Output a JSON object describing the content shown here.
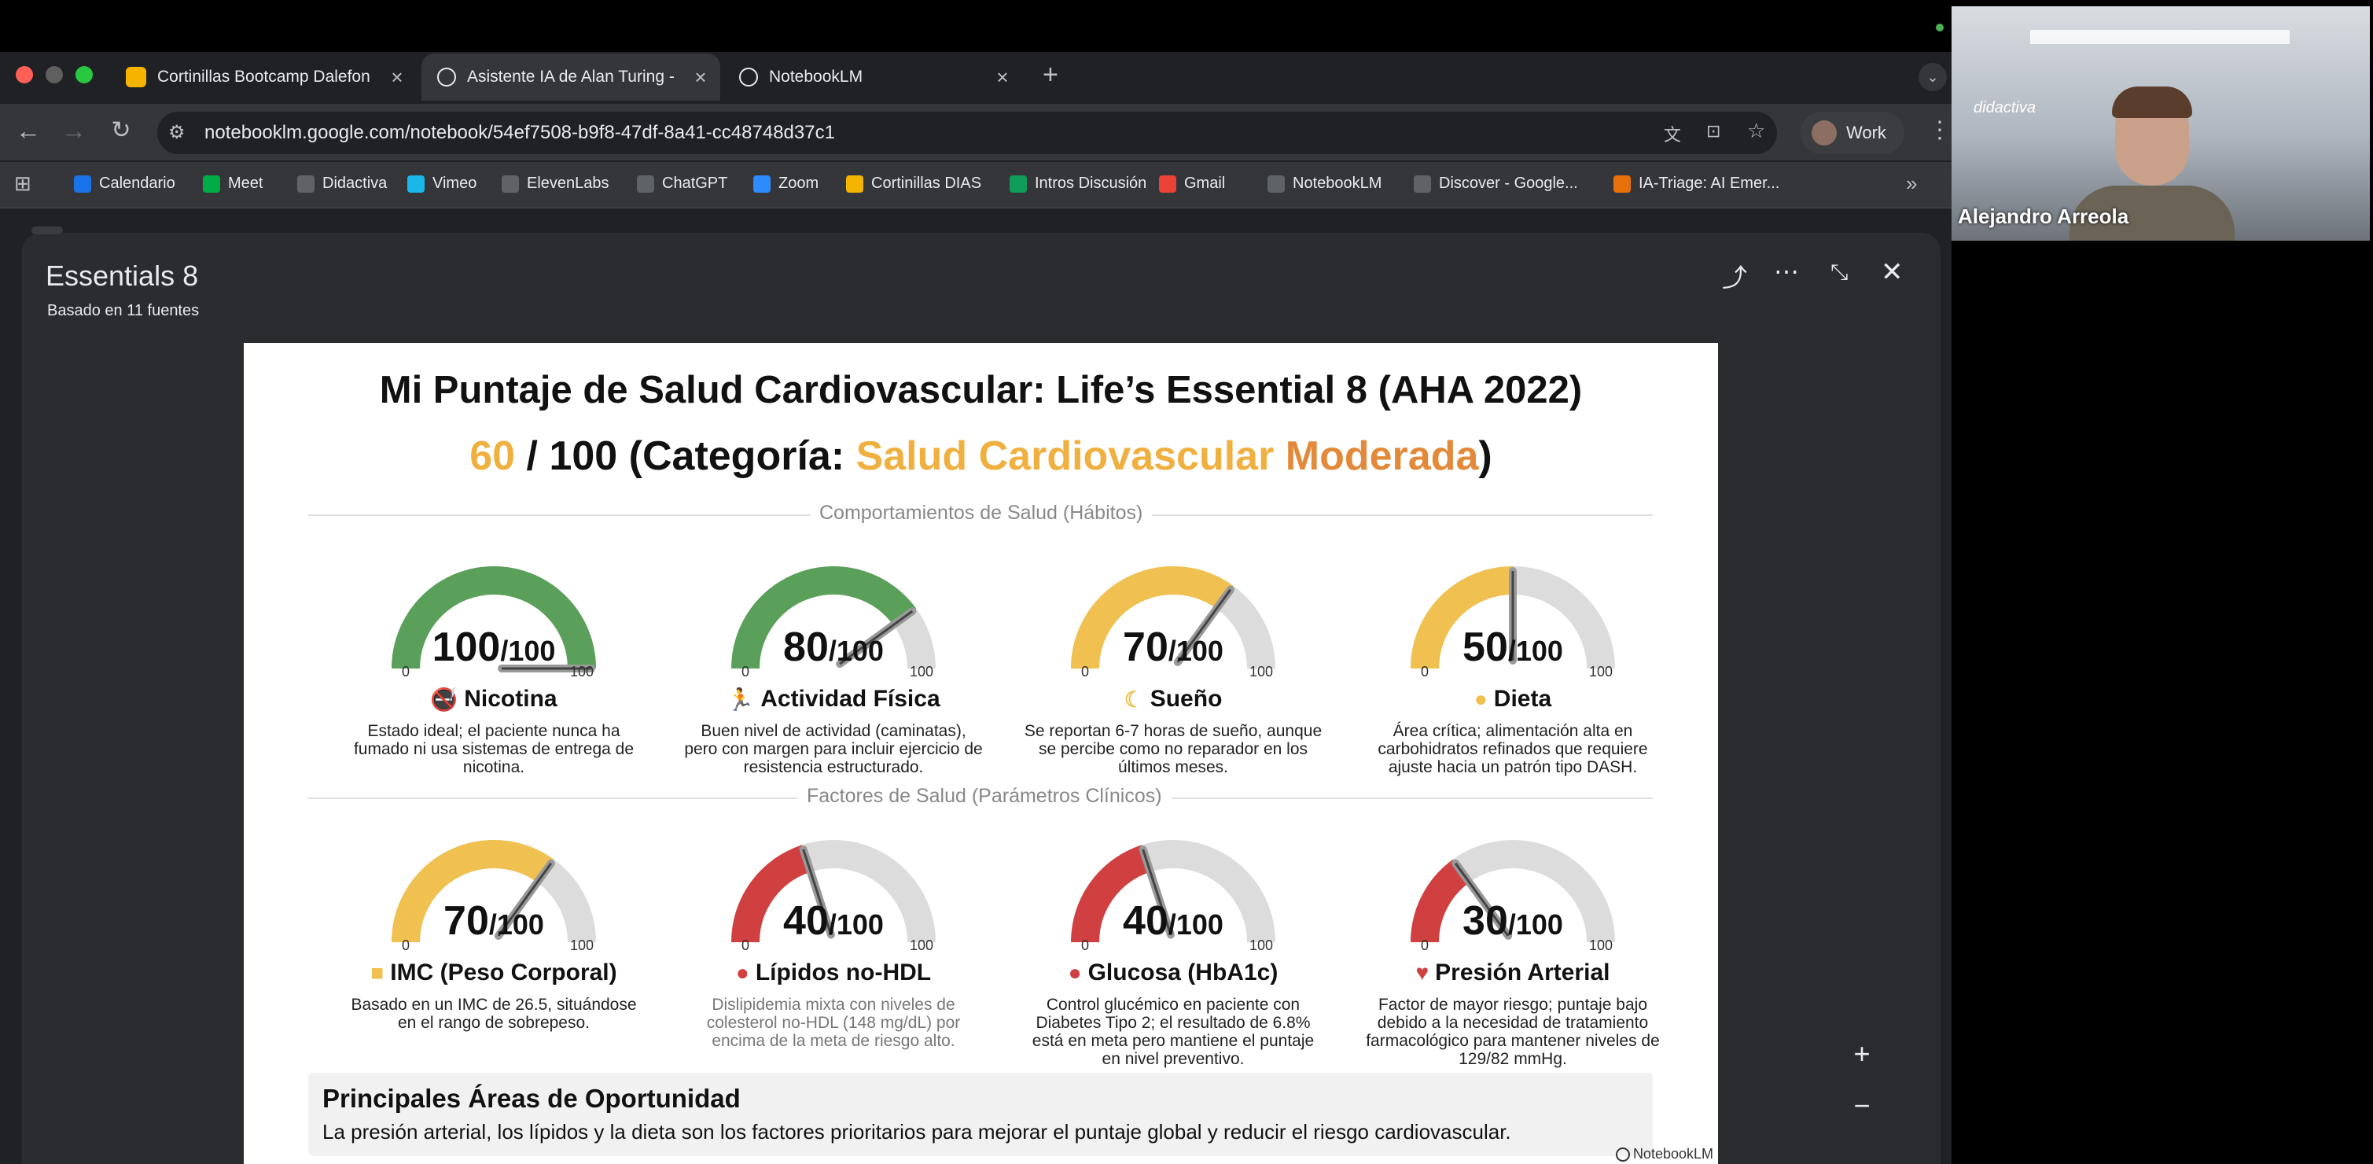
{
  "browser": {
    "tabs": [
      {
        "label": "Cortinillas Bootcamp Dalefon",
        "icon": "slides-icon"
      },
      {
        "label": "Asistente IA de Alan Turing - ",
        "icon": "notebooklm-icon",
        "active": true
      },
      {
        "label": "NotebookLM",
        "icon": "notebooklm-icon"
      }
    ],
    "url": "notebooklm.google.com/notebook/54ef7508-b9f8-47df-8a41-cc48748d37c1",
    "profile_label": "Work",
    "bookmarks": [
      {
        "label": "Calendario",
        "color": "#1a73e8"
      },
      {
        "label": "Meet",
        "color": "#00ac47"
      },
      {
        "label": "Didactiva",
        "color": "#5f6368"
      },
      {
        "label": "Vimeo",
        "color": "#1ab7ea"
      },
      {
        "label": "ElevenLabs",
        "color": "#5f6368"
      },
      {
        "label": "ChatGPT",
        "color": "#5f6368"
      },
      {
        "label": "Zoom",
        "color": "#2d8cff"
      },
      {
        "label": "Cortinillas DIAS",
        "color": "#f4b400"
      },
      {
        "label": "Intros Discusión",
        "color": "#0f9d58"
      },
      {
        "label": "Gmail",
        "color": "#ea4335"
      },
      {
        "label": "NotebookLM",
        "color": "#5f6368"
      },
      {
        "label": "Discover - Google...",
        "color": "#5f6368"
      },
      {
        "label": "IA-Triage: AI Emer...",
        "color": "#e8710a"
      }
    ]
  },
  "notebook": {
    "title": "Essentials 8",
    "subtitle": "Basado en 11 fuentes"
  },
  "infographic": {
    "title": "Mi Puntaje de Salud Cardiovascular: Life’s Essential 8 (AHA 2022)",
    "score_value": "60",
    "score_sep": " / 100 (Categoría: ",
    "category_word1": "Salud Cardiovascular",
    "category_word2": "Moderada",
    "score_close": ")",
    "section1": "Comportamientos de Salud (Hábitos)",
    "section2": "Factores de Salud (Parámetros Clínicos)",
    "tick_min": "0",
    "tick_max": "100",
    "out_of": "/100",
    "gauges": [
      {
        "score": 100,
        "title": "Nicotina",
        "icon": "no-smoking-icon",
        "desc": "Estado ideal; el paciente nunca ha fumado ni usa sistemas de entrega de nicotina.",
        "color": "#5aa05a"
      },
      {
        "score": 80,
        "title": "Actividad Física",
        "icon": "running-icon",
        "desc": "Buen nivel de actividad (caminatas), pero con margen para incluir ejercicio de resistencia estructurado.",
        "color": "#5aa05a"
      },
      {
        "score": 70,
        "title": "Sueño",
        "icon": "moon-icon",
        "desc": "Se reportan 6-7 horas de sueño, aunque se percibe como no reparador en los últimos meses.",
        "color": "#f0c050"
      },
      {
        "score": 50,
        "title": "Dieta",
        "icon": "bowl-icon",
        "desc": "Área crítica; alimentación alta en carbohidratos refinados que requiere ajuste hacia un patrón tipo DASH.",
        "color": "#f0c050"
      },
      {
        "score": 70,
        "title": "IMC (Peso Corporal)",
        "icon": "scale-icon",
        "desc": "Basado en un IMC de 26.5, situándose en el rango de sobrepeso.",
        "color": "#f0c050"
      },
      {
        "score": 40,
        "title": "Lípidos no-HDL",
        "icon": "drop-icon",
        "desc": "Dislipidemia mixta con niveles de colesterol no-HDL (148 mg/dL) por encima de la meta de riesgo alto.",
        "color": "#d04040",
        "muted": true
      },
      {
        "score": 40,
        "title": "Glucosa (HbA1c)",
        "icon": "blood-drop-icon",
        "desc": "Control glucémico en paciente con Diabetes Tipo 2; el resultado de 6.8% está en meta pero mantiene el puntaje en nivel preventivo.",
        "color": "#d04040"
      },
      {
        "score": 30,
        "title": "Presión Arterial",
        "icon": "heart-pulse-icon",
        "desc": "Factor de mayor riesgo; puntaje bajo debido a la necesidad de tratamiento farmacológico para mantener niveles de 129/82 mmHg.",
        "color": "#d04040"
      }
    ],
    "opportunity_title": "Principales Áreas de Oportunidad",
    "opportunity_text": "La presión arterial, los lípidos y la dieta son los factores prioritarios para mejorar el puntaje global y reducir el riesgo cardiovascular.",
    "watermark": "NotebookLM"
  },
  "video": {
    "name": "Alejandro Arreola",
    "logo_text": "didactiva"
  },
  "colors": {
    "score_orange": "#f0b040",
    "cat_orange1": "#f0b040",
    "cat_orange2": "#e38a3a"
  }
}
